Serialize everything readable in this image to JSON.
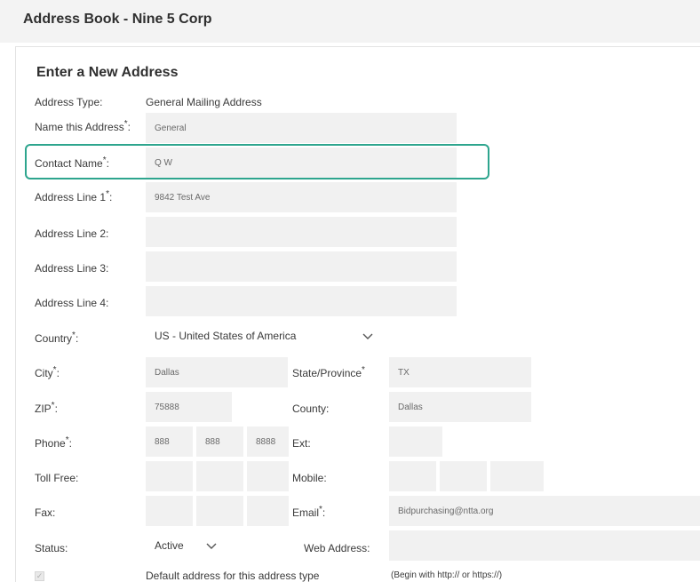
{
  "header": {
    "title": "Address Book - Nine 5 Corp"
  },
  "form": {
    "title": "Enter a New Address",
    "required_marker": "*",
    "address_type": {
      "label": "Address Type:",
      "value": "General Mailing Address"
    },
    "name_address": {
      "label": "Name this Address",
      "suffix": ":",
      "value": "General"
    },
    "contact_name": {
      "label": "Contact Name",
      "suffix": ":",
      "value": "Q W"
    },
    "address_line_1": {
      "label": "Address Line 1",
      "suffix": ":",
      "value": "9842 Test Ave"
    },
    "address_line_2": {
      "label": "Address Line 2:",
      "value": ""
    },
    "address_line_3": {
      "label": "Address Line 3:",
      "value": ""
    },
    "address_line_4": {
      "label": "Address Line 4:",
      "value": ""
    },
    "country": {
      "label": "Country",
      "suffix": ":",
      "value": "US - United States of America"
    },
    "city": {
      "label": "City",
      "suffix": ":",
      "value": "Dallas"
    },
    "state": {
      "label": "State/Province",
      "value": "TX"
    },
    "zip": {
      "label": "ZIP",
      "suffix": ":",
      "value": "75888"
    },
    "county": {
      "label": "County:",
      "value": "Dallas"
    },
    "phone": {
      "label": "Phone",
      "suffix": ":",
      "area": "888",
      "prefix": "888",
      "line": "8888"
    },
    "ext": {
      "label": "Ext:",
      "value": ""
    },
    "toll_free": {
      "label": "Toll Free:",
      "area": "",
      "prefix": "",
      "line": ""
    },
    "mobile": {
      "label": "Mobile:",
      "area": "",
      "prefix": "",
      "line": ""
    },
    "fax": {
      "label": "Fax:",
      "area": "",
      "prefix": "",
      "line": ""
    },
    "email": {
      "label": "Email",
      "suffix": ":",
      "value": "Bidpurchasing@ntta.org"
    },
    "status": {
      "label": "Status:",
      "value": "Active"
    },
    "web_address": {
      "label": "Web Address:",
      "value": "",
      "hint": "(Begin with http:// or https://)"
    },
    "default_checkbox": {
      "label": "Default address for this address type",
      "mark": "✓"
    }
  },
  "style": {
    "highlight_color": "#2ea58e",
    "field_bg": "#f1f1f1"
  },
  "icons": {
    "select_arrow": "chevron-down-icon"
  }
}
